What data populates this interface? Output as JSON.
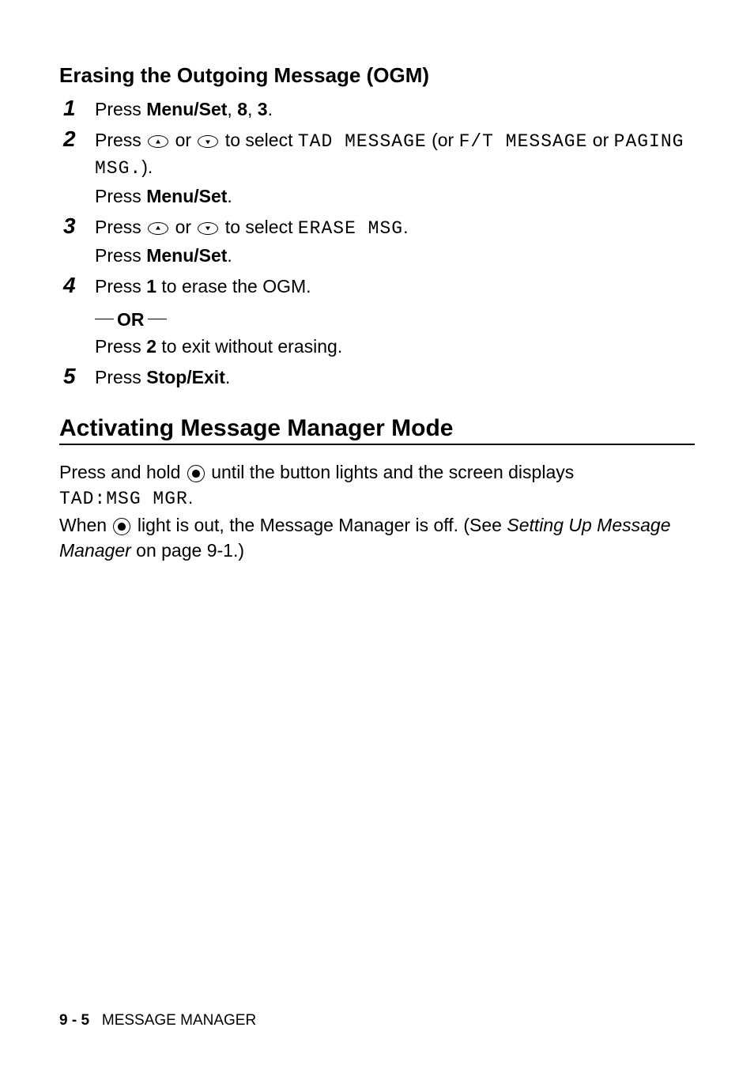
{
  "section1": {
    "title": "Erasing the Outgoing Message (OGM)",
    "steps": [
      {
        "num": "1",
        "lines": [
          {
            "parts": [
              {
                "t": "Press "
              },
              {
                "t": "Menu/Set",
                "b": true
              },
              {
                "t": ", "
              },
              {
                "t": "8",
                "b": true
              },
              {
                "t": ", "
              },
              {
                "t": "3",
                "b": true
              },
              {
                "t": "."
              }
            ]
          }
        ]
      },
      {
        "num": "2",
        "lines": [
          {
            "parts": [
              {
                "t": "Press "
              },
              {
                "icon": "up"
              },
              {
                "t": " or "
              },
              {
                "icon": "down"
              },
              {
                "t": " to select "
              },
              {
                "t": "TAD MESSAGE",
                "m": true
              },
              {
                "t": " (or "
              },
              {
                "t": "F/T MESSAGE",
                "m": true
              },
              {
                "t": " or "
              },
              {
                "t": "PAGING MSG.",
                "m": true
              },
              {
                "t": ")."
              }
            ]
          },
          {
            "parts": [
              {
                "t": "Press "
              },
              {
                "t": "Menu/Set",
                "b": true
              },
              {
                "t": "."
              }
            ]
          }
        ]
      },
      {
        "num": "3",
        "lines": [
          {
            "parts": [
              {
                "t": "Press "
              },
              {
                "icon": "up"
              },
              {
                "t": " or "
              },
              {
                "icon": "down"
              },
              {
                "t": " to select "
              },
              {
                "t": "ERASE MSG",
                "m": true
              },
              {
                "t": "."
              }
            ]
          },
          {
            "parts": [
              {
                "t": "Press "
              },
              {
                "t": "Menu/Set",
                "b": true
              },
              {
                "t": "."
              }
            ]
          }
        ]
      },
      {
        "num": "4",
        "lines": [
          {
            "parts": [
              {
                "t": "Press "
              },
              {
                "t": "1",
                "b": true
              },
              {
                "t": " to erase the OGM."
              }
            ]
          },
          {
            "or": true,
            "text": "OR"
          },
          {
            "parts": [
              {
                "t": "Press "
              },
              {
                "t": "2",
                "b": true
              },
              {
                "t": " to exit without erasing."
              }
            ]
          }
        ]
      },
      {
        "num": "5",
        "lines": [
          {
            "parts": [
              {
                "t": "Press "
              },
              {
                "t": "Stop/Exit",
                "b": true
              },
              {
                "t": "."
              }
            ]
          }
        ]
      }
    ]
  },
  "section2": {
    "title": "Activating Message Manager Mode",
    "para1_a": "Press and hold ",
    "para1_b": " until the button lights and the screen displays",
    "para1_mono": "TAD:MSG MGR",
    "para1_c": ".",
    "para2_a": "When ",
    "para2_b": " light is out, the Message Manager is off. (See ",
    "para2_italic": "Setting Up Message Manager",
    "para2_c": " on page 9-1.)"
  },
  "footer": {
    "page": "9 - 5",
    "label": "MESSAGE MANAGER"
  }
}
